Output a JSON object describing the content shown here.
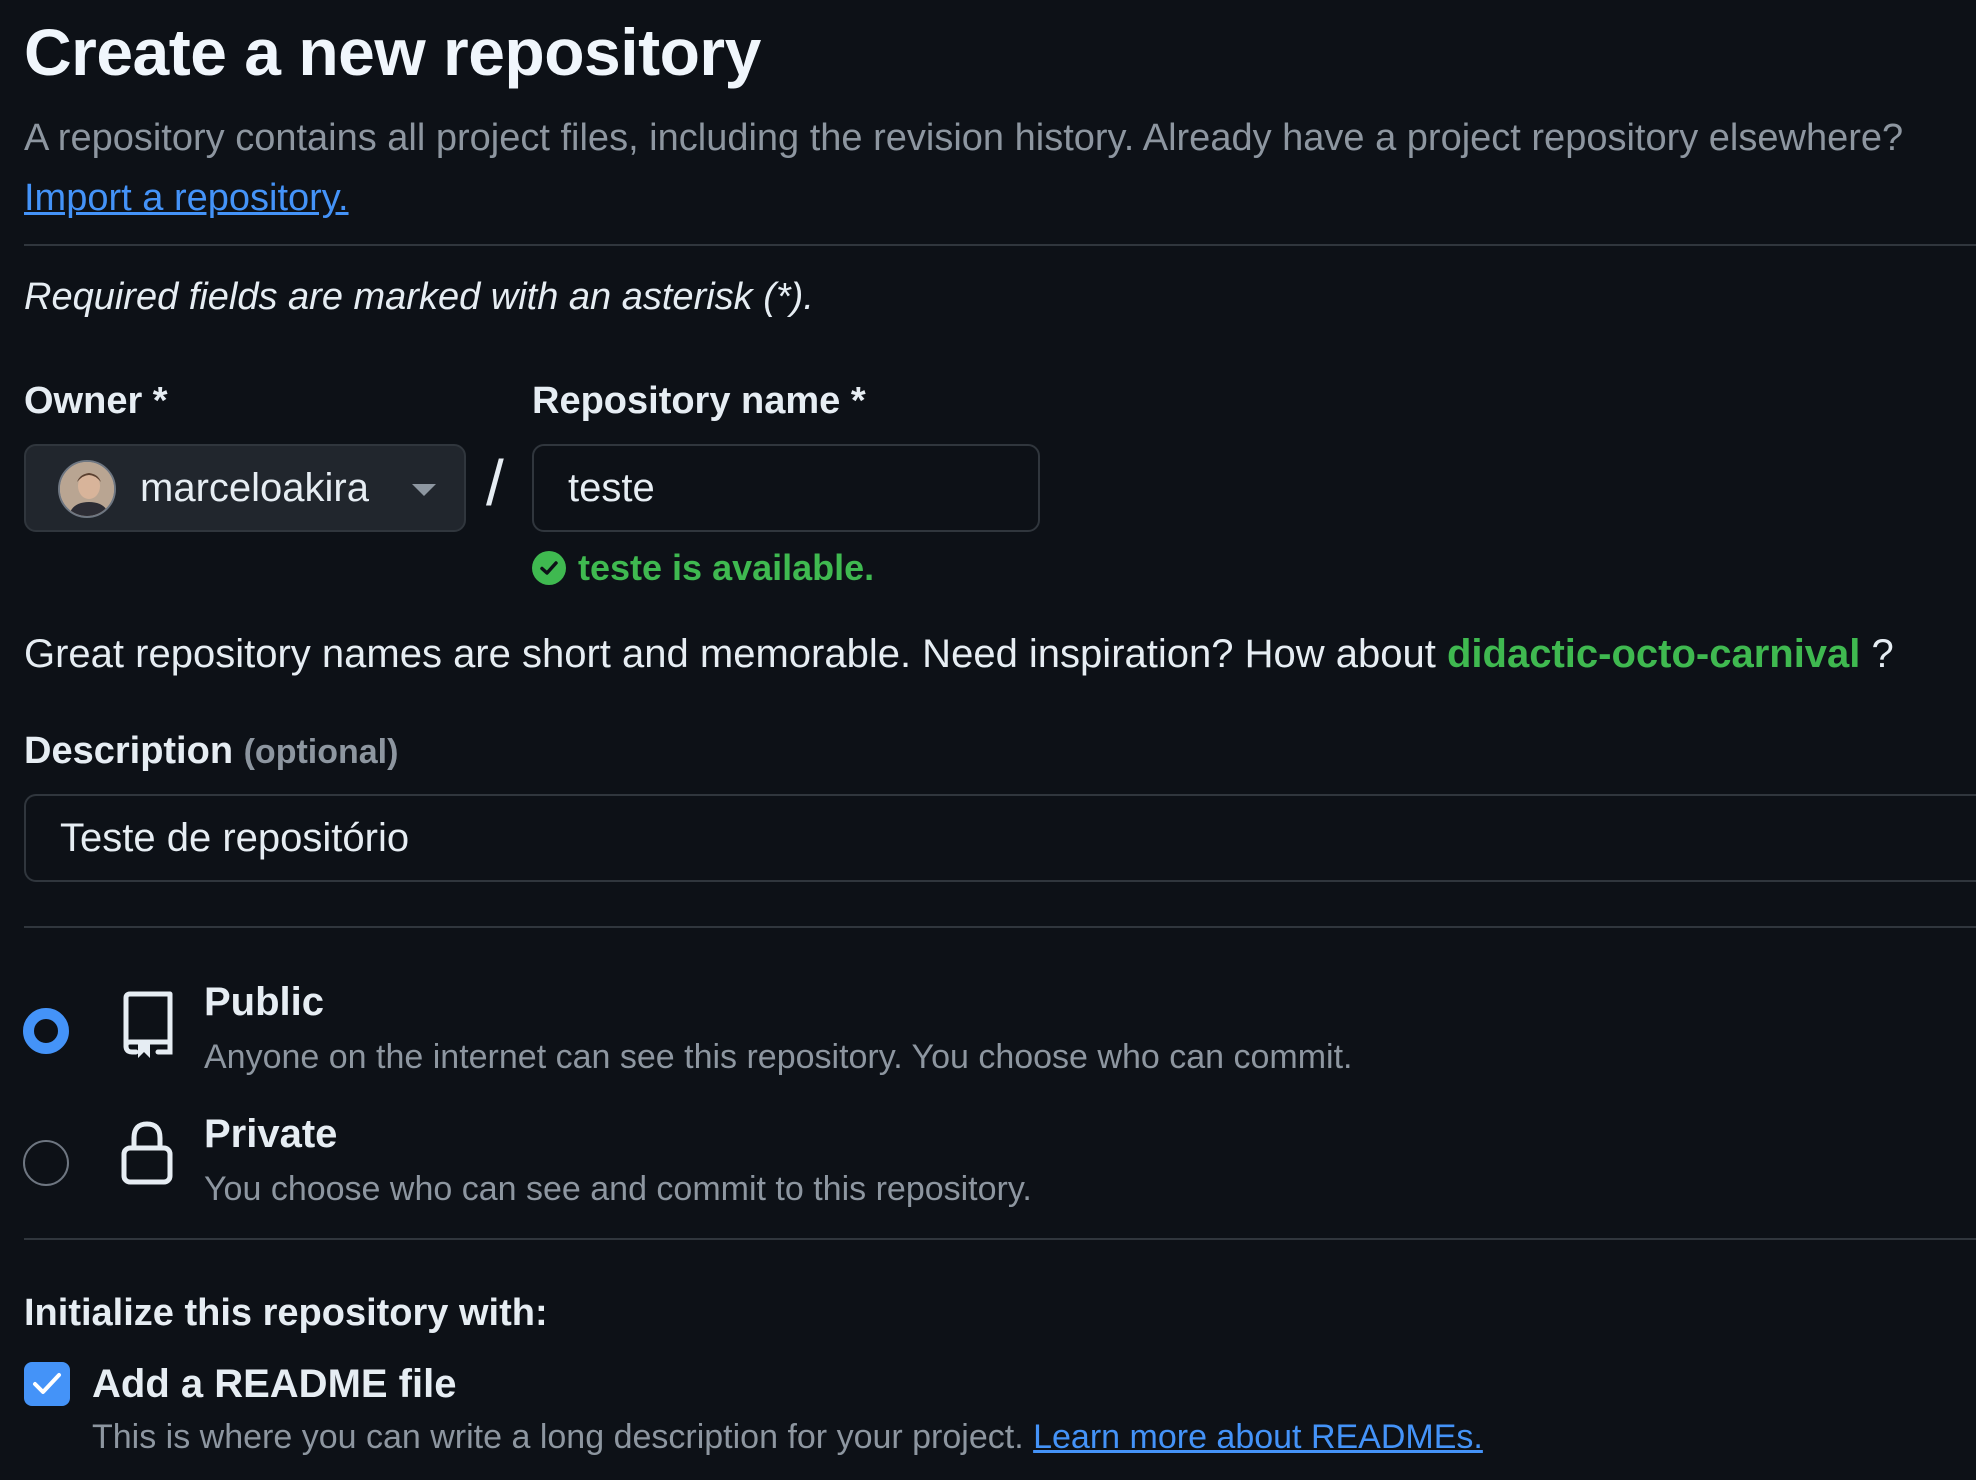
{
  "page": {
    "title": "Create a new repository",
    "subtitle_text": "A repository contains all project files, including the revision history. Already have a project repository elsewhere?",
    "import_link": "Import a repository.",
    "required_note": "Required fields are marked with an asterisk (*)."
  },
  "owner": {
    "label": "Owner *",
    "selected": "marceloakira"
  },
  "separator": "/",
  "repo_name": {
    "label": "Repository name *",
    "value": "teste",
    "availability": "teste is available."
  },
  "inspiration": {
    "text": "Great repository names are short and memorable. Need inspiration? How about",
    "suggestion": "didactic-octo-carnival",
    "suffix": "?"
  },
  "description": {
    "label": "Description",
    "optional": "(optional)",
    "value": "Teste de repositório"
  },
  "visibility": {
    "options": [
      {
        "title": "Public",
        "description": "Anyone on the internet can see this repository. You choose who can commit.",
        "selected": true,
        "icon": "repo-icon"
      },
      {
        "title": "Private",
        "description": "You choose who can see and commit to this repository.",
        "selected": false,
        "icon": "lock-icon"
      }
    ]
  },
  "initialize": {
    "heading": "Initialize this repository with:",
    "readme": {
      "label": "Add a README file",
      "checked": true,
      "description": "This is where you can write a long description for your project.",
      "link": "Learn more about READMEs."
    }
  },
  "colors": {
    "background": "#0d1117",
    "accent_blue": "#4493f8",
    "success_green": "#3fb950",
    "muted_text": "#8d96a0",
    "border": "#30363d"
  }
}
